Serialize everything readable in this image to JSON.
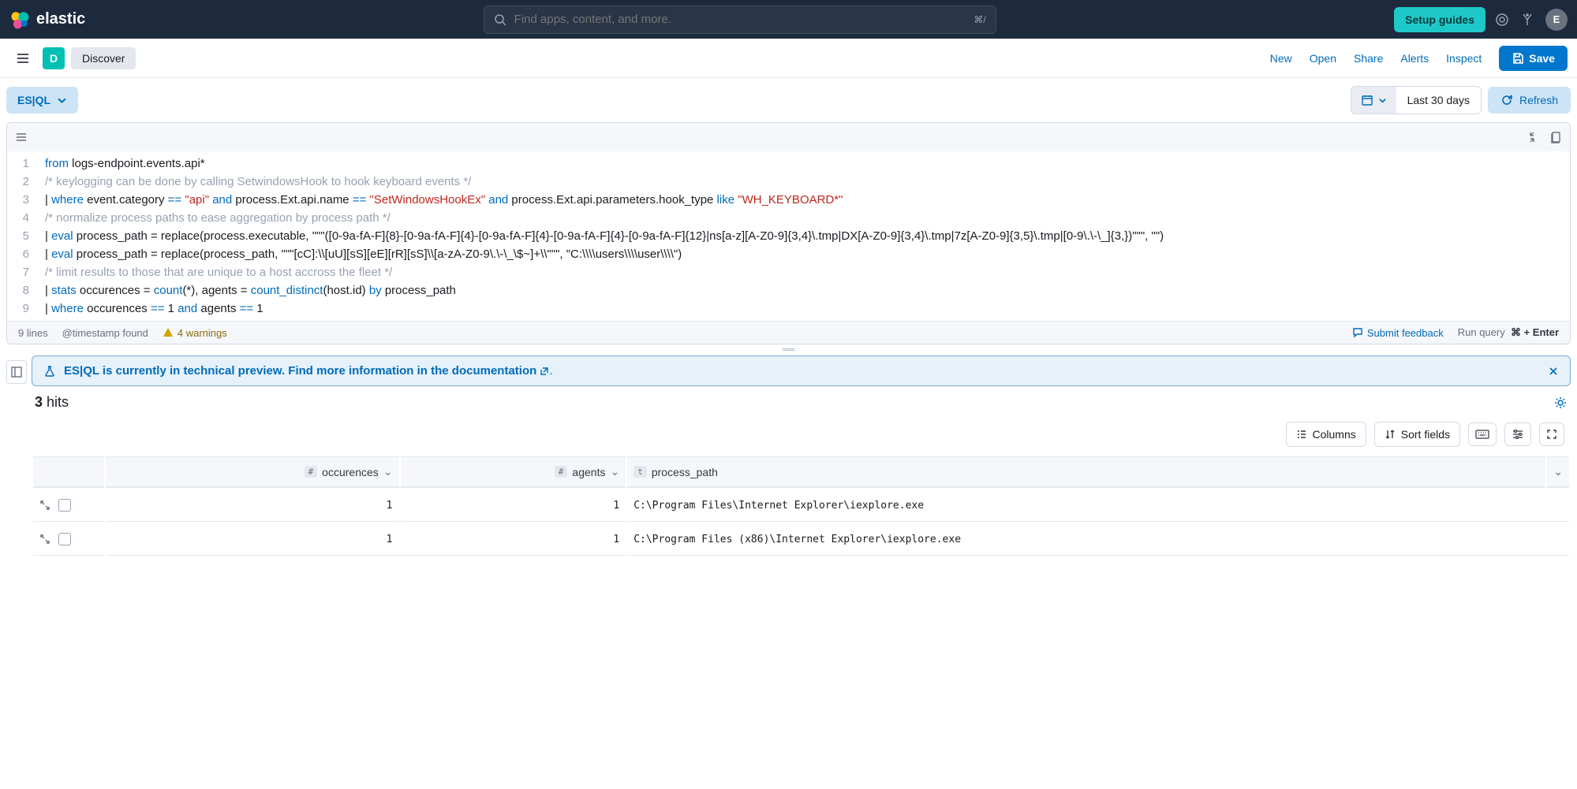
{
  "header": {
    "brand": "elastic",
    "search_placeholder": "Find apps, content, and more.",
    "kbd_hint": "⌘/",
    "setup_guides": "Setup guides",
    "avatar_initial": "E"
  },
  "subbar": {
    "badge": "D",
    "app_name": "Discover",
    "links": {
      "new": "New",
      "open": "Open",
      "share": "Share",
      "alerts": "Alerts",
      "inspect": "Inspect"
    },
    "save": "Save"
  },
  "controls": {
    "esql": "ES|QL",
    "date_range": "Last 30 days",
    "refresh": "Refresh"
  },
  "editor": {
    "line_nums": [
      "1",
      "2",
      "3",
      "4",
      "5",
      "",
      "6",
      "7",
      "8",
      "9"
    ],
    "status_lines": "9 lines",
    "timestamp": "@timestamp found",
    "warnings": "4 warnings",
    "feedback": "Submit feedback",
    "run_label": "Run query",
    "run_kbd": "⌘ + Enter"
  },
  "code": {
    "l1a": "from",
    "l1b": " logs-endpoint.events.api*",
    "l2": "/* keylogging can be done by calling SetwindowsHook to hook keyboard events */",
    "l3a": "| ",
    "l3b": "where",
    "l3c": " event.category ",
    "l3d": "==",
    "l3e": " \"api\" ",
    "l3f": "and",
    "l3g": " process.Ext.api.name ",
    "l3h": "==",
    "l3i": " \"SetWindowsHookEx\" ",
    "l3j": "and",
    "l3k": " process.Ext.api.parameters.hook_type ",
    "l3l": "like",
    "l3m": " \"WH_KEYBOARD*\"",
    "l4": "/* normalize process paths to ease aggregation by process path */",
    "l5a": "| ",
    "l5b": "eval",
    "l5c": " process_path = replace(process.executable, \"\"\"([0-9a-fA-F]{8}-[0-9a-fA-F]{4}-[0-9a-fA-F]{4}-[0-9a-fA-F]{4}-[0-9a-fA-F]{12}|ns[a-z][A-Z0-9]{3,4}\\.tmp|DX[A-Z0-9]{3,4}\\.tmp|7z[A-Z0-9]{3,5}\\.tmp|[0-9\\.\\-\\_]{3,})\"\"\", \"\")",
    "l6a": "| ",
    "l6b": "eval",
    "l6c": " process_path = replace(process_path, \"\"\"[cC]:\\\\[uU][sS][eE][rR][sS]\\\\[a-zA-Z0-9\\.\\-\\_\\$~]+\\\\\"\"\", \"C:\\\\\\\\users\\\\\\\\user\\\\\\\\\")",
    "l7": "/* limit results to those that are unique to a host accross the fleet */",
    "l8a": "| ",
    "l8b": "stats",
    "l8c": " occurences = ",
    "l8d": "count",
    "l8e": "(*), agents = ",
    "l8f": "count_distinct",
    "l8g": "(host.id) ",
    "l8h": "by",
    "l8i": " process_path",
    "l9a": "| ",
    "l9b": "where",
    "l9c": " occurences ",
    "l9d": "==",
    "l9e": " 1 ",
    "l9f": "and",
    "l9g": " agents ",
    "l9h": "==",
    "l9i": " 1"
  },
  "banner": {
    "text": "ES|QL is currently in technical preview. Find more information in the documentation",
    "suffix": "."
  },
  "results": {
    "hits_count": "3",
    "hits_label": "hits",
    "columns_btn": "Columns",
    "sort_btn": "Sort fields",
    "columns": {
      "occurences": "occurences",
      "agents": "agents",
      "process_path": "process_path"
    },
    "rows": [
      {
        "occurences": "1",
        "agents": "1",
        "process_path": "C:\\Program Files\\Internet Explorer\\iexplore.exe"
      },
      {
        "occurences": "1",
        "agents": "1",
        "process_path": "C:\\Program Files (x86)\\Internet Explorer\\iexplore.exe"
      }
    ]
  }
}
